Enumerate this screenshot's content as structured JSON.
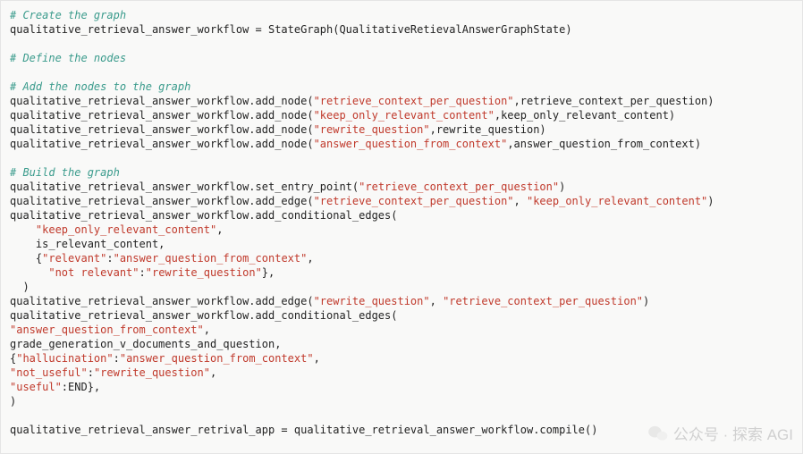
{
  "lines": [
    {
      "t": "comment",
      "text": "# Create the graph"
    },
    {
      "t": "plain",
      "seg": [
        [
          "plain",
          "qualitative_retrieval_answer_workflow = StateGraph(QualitativeRetievalAnswerGraphState)"
        ]
      ]
    },
    {
      "t": "blank"
    },
    {
      "t": "comment",
      "text": "# Define the nodes"
    },
    {
      "t": "blank"
    },
    {
      "t": "comment",
      "text": "# Add the nodes to the graph"
    },
    {
      "t": "plain",
      "seg": [
        [
          "plain",
          "qualitative_retrieval_answer_workflow.add_node("
        ],
        [
          "str",
          "\"retrieve_context_per_question\""
        ],
        [
          "plain",
          ",retrieve_context_per_question)"
        ]
      ]
    },
    {
      "t": "plain",
      "seg": [
        [
          "plain",
          "qualitative_retrieval_answer_workflow.add_node("
        ],
        [
          "str",
          "\"keep_only_relevant_content\""
        ],
        [
          "plain",
          ",keep_only_relevant_content)"
        ]
      ]
    },
    {
      "t": "plain",
      "seg": [
        [
          "plain",
          "qualitative_retrieval_answer_workflow.add_node("
        ],
        [
          "str",
          "\"rewrite_question\""
        ],
        [
          "plain",
          ",rewrite_question)"
        ]
      ]
    },
    {
      "t": "plain",
      "seg": [
        [
          "plain",
          "qualitative_retrieval_answer_workflow.add_node("
        ],
        [
          "str",
          "\"answer_question_from_context\""
        ],
        [
          "plain",
          ",answer_question_from_context)"
        ]
      ]
    },
    {
      "t": "blank"
    },
    {
      "t": "comment",
      "text": "# Build the graph"
    },
    {
      "t": "plain",
      "seg": [
        [
          "plain",
          "qualitative_retrieval_answer_workflow.set_entry_point("
        ],
        [
          "str",
          "\"retrieve_context_per_question\""
        ],
        [
          "plain",
          ")"
        ]
      ]
    },
    {
      "t": "plain",
      "seg": [
        [
          "plain",
          "qualitative_retrieval_answer_workflow.add_edge("
        ],
        [
          "str",
          "\"retrieve_context_per_question\""
        ],
        [
          "plain",
          ", "
        ],
        [
          "str",
          "\"keep_only_relevant_content\""
        ],
        [
          "plain",
          ")"
        ]
      ]
    },
    {
      "t": "plain",
      "seg": [
        [
          "plain",
          "qualitative_retrieval_answer_workflow.add_conditional_edges("
        ]
      ]
    },
    {
      "t": "plain",
      "seg": [
        [
          "plain",
          "    "
        ],
        [
          "str",
          "\"keep_only_relevant_content\""
        ],
        [
          "plain",
          ","
        ]
      ]
    },
    {
      "t": "plain",
      "seg": [
        [
          "plain",
          "    is_relevant_content,"
        ]
      ]
    },
    {
      "t": "plain",
      "seg": [
        [
          "plain",
          "    {"
        ],
        [
          "str",
          "\"relevant\""
        ],
        [
          "plain",
          ":"
        ],
        [
          "str",
          "\"answer_question_from_context\""
        ],
        [
          "plain",
          ","
        ]
      ]
    },
    {
      "t": "plain",
      "seg": [
        [
          "plain",
          "      "
        ],
        [
          "str",
          "\"not relevant\""
        ],
        [
          "plain",
          ":"
        ],
        [
          "str",
          "\"rewrite_question\""
        ],
        [
          "plain",
          "},"
        ]
      ]
    },
    {
      "t": "plain",
      "seg": [
        [
          "plain",
          "  )"
        ]
      ]
    },
    {
      "t": "plain",
      "seg": [
        [
          "plain",
          "qualitative_retrieval_answer_workflow.add_edge("
        ],
        [
          "str",
          "\"rewrite_question\""
        ],
        [
          "plain",
          ", "
        ],
        [
          "str",
          "\"retrieve_context_per_question\""
        ],
        [
          "plain",
          ")"
        ]
      ]
    },
    {
      "t": "plain",
      "seg": [
        [
          "plain",
          "qualitative_retrieval_answer_workflow.add_conditional_edges("
        ]
      ]
    },
    {
      "t": "plain",
      "seg": [
        [
          "str",
          "\"answer_question_from_context\""
        ],
        [
          "plain",
          ","
        ]
      ]
    },
    {
      "t": "plain",
      "seg": [
        [
          "plain",
          "grade_generation_v_documents_and_question,"
        ]
      ]
    },
    {
      "t": "plain",
      "seg": [
        [
          "plain",
          "{"
        ],
        [
          "str",
          "\"hallucination\""
        ],
        [
          "plain",
          ":"
        ],
        [
          "str",
          "\"answer_question_from_context\""
        ],
        [
          "plain",
          ","
        ]
      ]
    },
    {
      "t": "plain",
      "seg": [
        [
          "str",
          "\"not_useful\""
        ],
        [
          "plain",
          ":"
        ],
        [
          "str",
          "\"rewrite_question\""
        ],
        [
          "plain",
          ","
        ]
      ]
    },
    {
      "t": "plain",
      "seg": [
        [
          "str",
          "\"useful\""
        ],
        [
          "plain",
          ":END},"
        ]
      ]
    },
    {
      "t": "plain",
      "seg": [
        [
          "plain",
          ")"
        ]
      ]
    },
    {
      "t": "blank"
    },
    {
      "t": "plain",
      "seg": [
        [
          "plain",
          "qualitative_retrieval_answer_retrival_app = qualitative_retrieval_answer_workflow.compile()"
        ]
      ]
    }
  ],
  "watermark": {
    "label": "公众号 · 探索 AGI"
  }
}
